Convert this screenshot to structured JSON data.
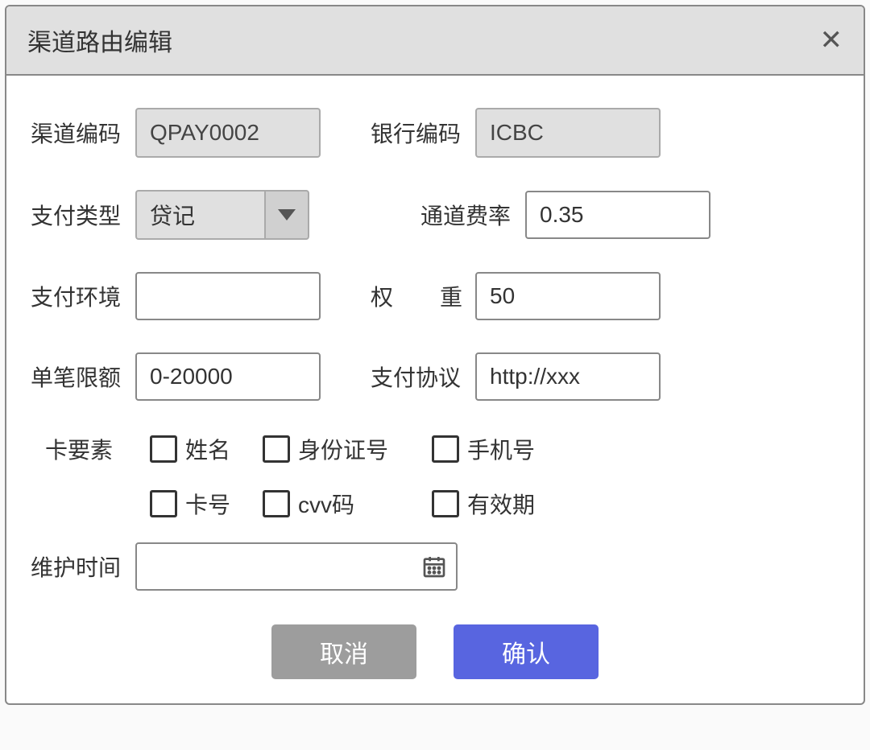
{
  "dialog": {
    "title": "渠道路由编辑"
  },
  "fields": {
    "channel_code": {
      "label": "渠道编码",
      "value": "QPAY0002"
    },
    "bank_code": {
      "label": "银行编码",
      "value": "ICBC"
    },
    "pay_type": {
      "label": "支付类型",
      "value": "贷记"
    },
    "channel_rate": {
      "label": "通道费率",
      "value": "0.35"
    },
    "pay_env": {
      "label": "支付环境",
      "value": ""
    },
    "weight": {
      "label_char1": "权",
      "label_char2": "重",
      "value": "50"
    },
    "single_limit": {
      "label": "单笔限额",
      "value": "0-20000"
    },
    "pay_protocol": {
      "label": "支付协议",
      "value": "http://xxx"
    },
    "maintain_time": {
      "label": "维护时间",
      "value": ""
    }
  },
  "card_elements": {
    "group_label": "卡要素",
    "row1": [
      {
        "label": "姓名"
      },
      {
        "label": "身份证号"
      },
      {
        "label": "手机号"
      }
    ],
    "row2": [
      {
        "label": "卡号"
      },
      {
        "label": "cvv码"
      },
      {
        "label": "有效期"
      }
    ]
  },
  "buttons": {
    "cancel": "取消",
    "confirm": "确认"
  }
}
